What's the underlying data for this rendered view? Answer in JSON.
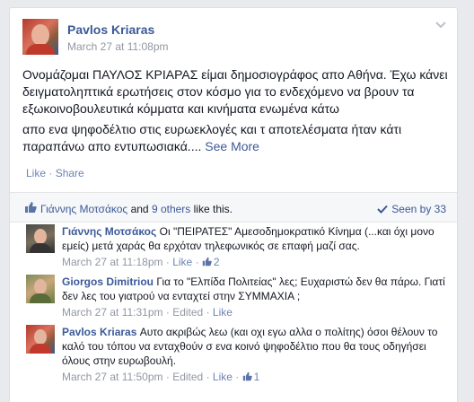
{
  "post": {
    "author": "Pavlos Kriaras",
    "timestamp": "March 27 at 11:08pm",
    "paragraph1": "Ονομάζομαι ΠΑΥΛΟΣ ΚΡΙΑΡΑΣ είμαι δημοσιογράφος απο Αθήνα. Έχω κάνει δειγματοληπτικά ερωτήσεις στον κόσμο για το ενδεχόμενο να βρουν τα εξωκοινοβουλευτικά κόμματα και κινήματα ενωμένα κάτω",
    "paragraph2": "απο ενα ψηφοδέλτιο στις ευρωεκλογές και τ αποτελέσματα ήταν κάτι παραπάνω απο εντυπωσιακά....",
    "see_more": "See More",
    "actions": {
      "like": "Like",
      "separator": "·",
      "share": "Share"
    }
  },
  "likes": {
    "name": "Γιάννης Μοτσάκος",
    "and": "and",
    "others": "9 others",
    "suffix": "like this.",
    "seen_by": "Seen by 33"
  },
  "comments": [
    {
      "name": "Γιάννης Μοτσάκος",
      "text": "Οι \"ΠΕΙΡΑΤΕΣ\" Αμεσοδημοκρατικό Κίνημα (...και όχι μονο εμείς) μετά χαράς θα ερχόταν τηλεφωνικός σε επαφή μαζί σας.",
      "time": "March 27 at 11:18pm",
      "like": "Like",
      "likes_count": "2"
    },
    {
      "name": "Giorgos Dimitriou",
      "text": "Για το \"Ελπίδα Πολιτείας\" λες; Ευχαριστώ δεν θα πάρω. Γιατί δεν λες του γιατρού να ενταχτεί στην ΣΥΜΜΑΧΙΑ ;",
      "time": "March 27 at 11:31pm",
      "edited": "Edited",
      "like": "Like"
    },
    {
      "name": "Pavlos Kriaras",
      "text": "Αυτο ακριβώς λεω (και οχι εγω αλλα ο πολίτης) όσοι θέλουν το καλό του τόπου να ενταχθούν σ ενα κοινό ψηφοδέλτιο που θα τους οδηγήσει όλους στην ευρωβουλή.",
      "time": "March 27 at 11:50pm",
      "edited": "Edited",
      "like": "Like",
      "likes_count": "1"
    }
  ],
  "separators": {
    "dot": "·"
  },
  "colors": {
    "link": "#3b5998",
    "muted": "#9197a3",
    "action": "#6d84b4",
    "bg": "#e9eaed"
  },
  "icons": [
    "chevron-down-icon",
    "thumbs-up-icon",
    "checkmark-icon"
  ]
}
